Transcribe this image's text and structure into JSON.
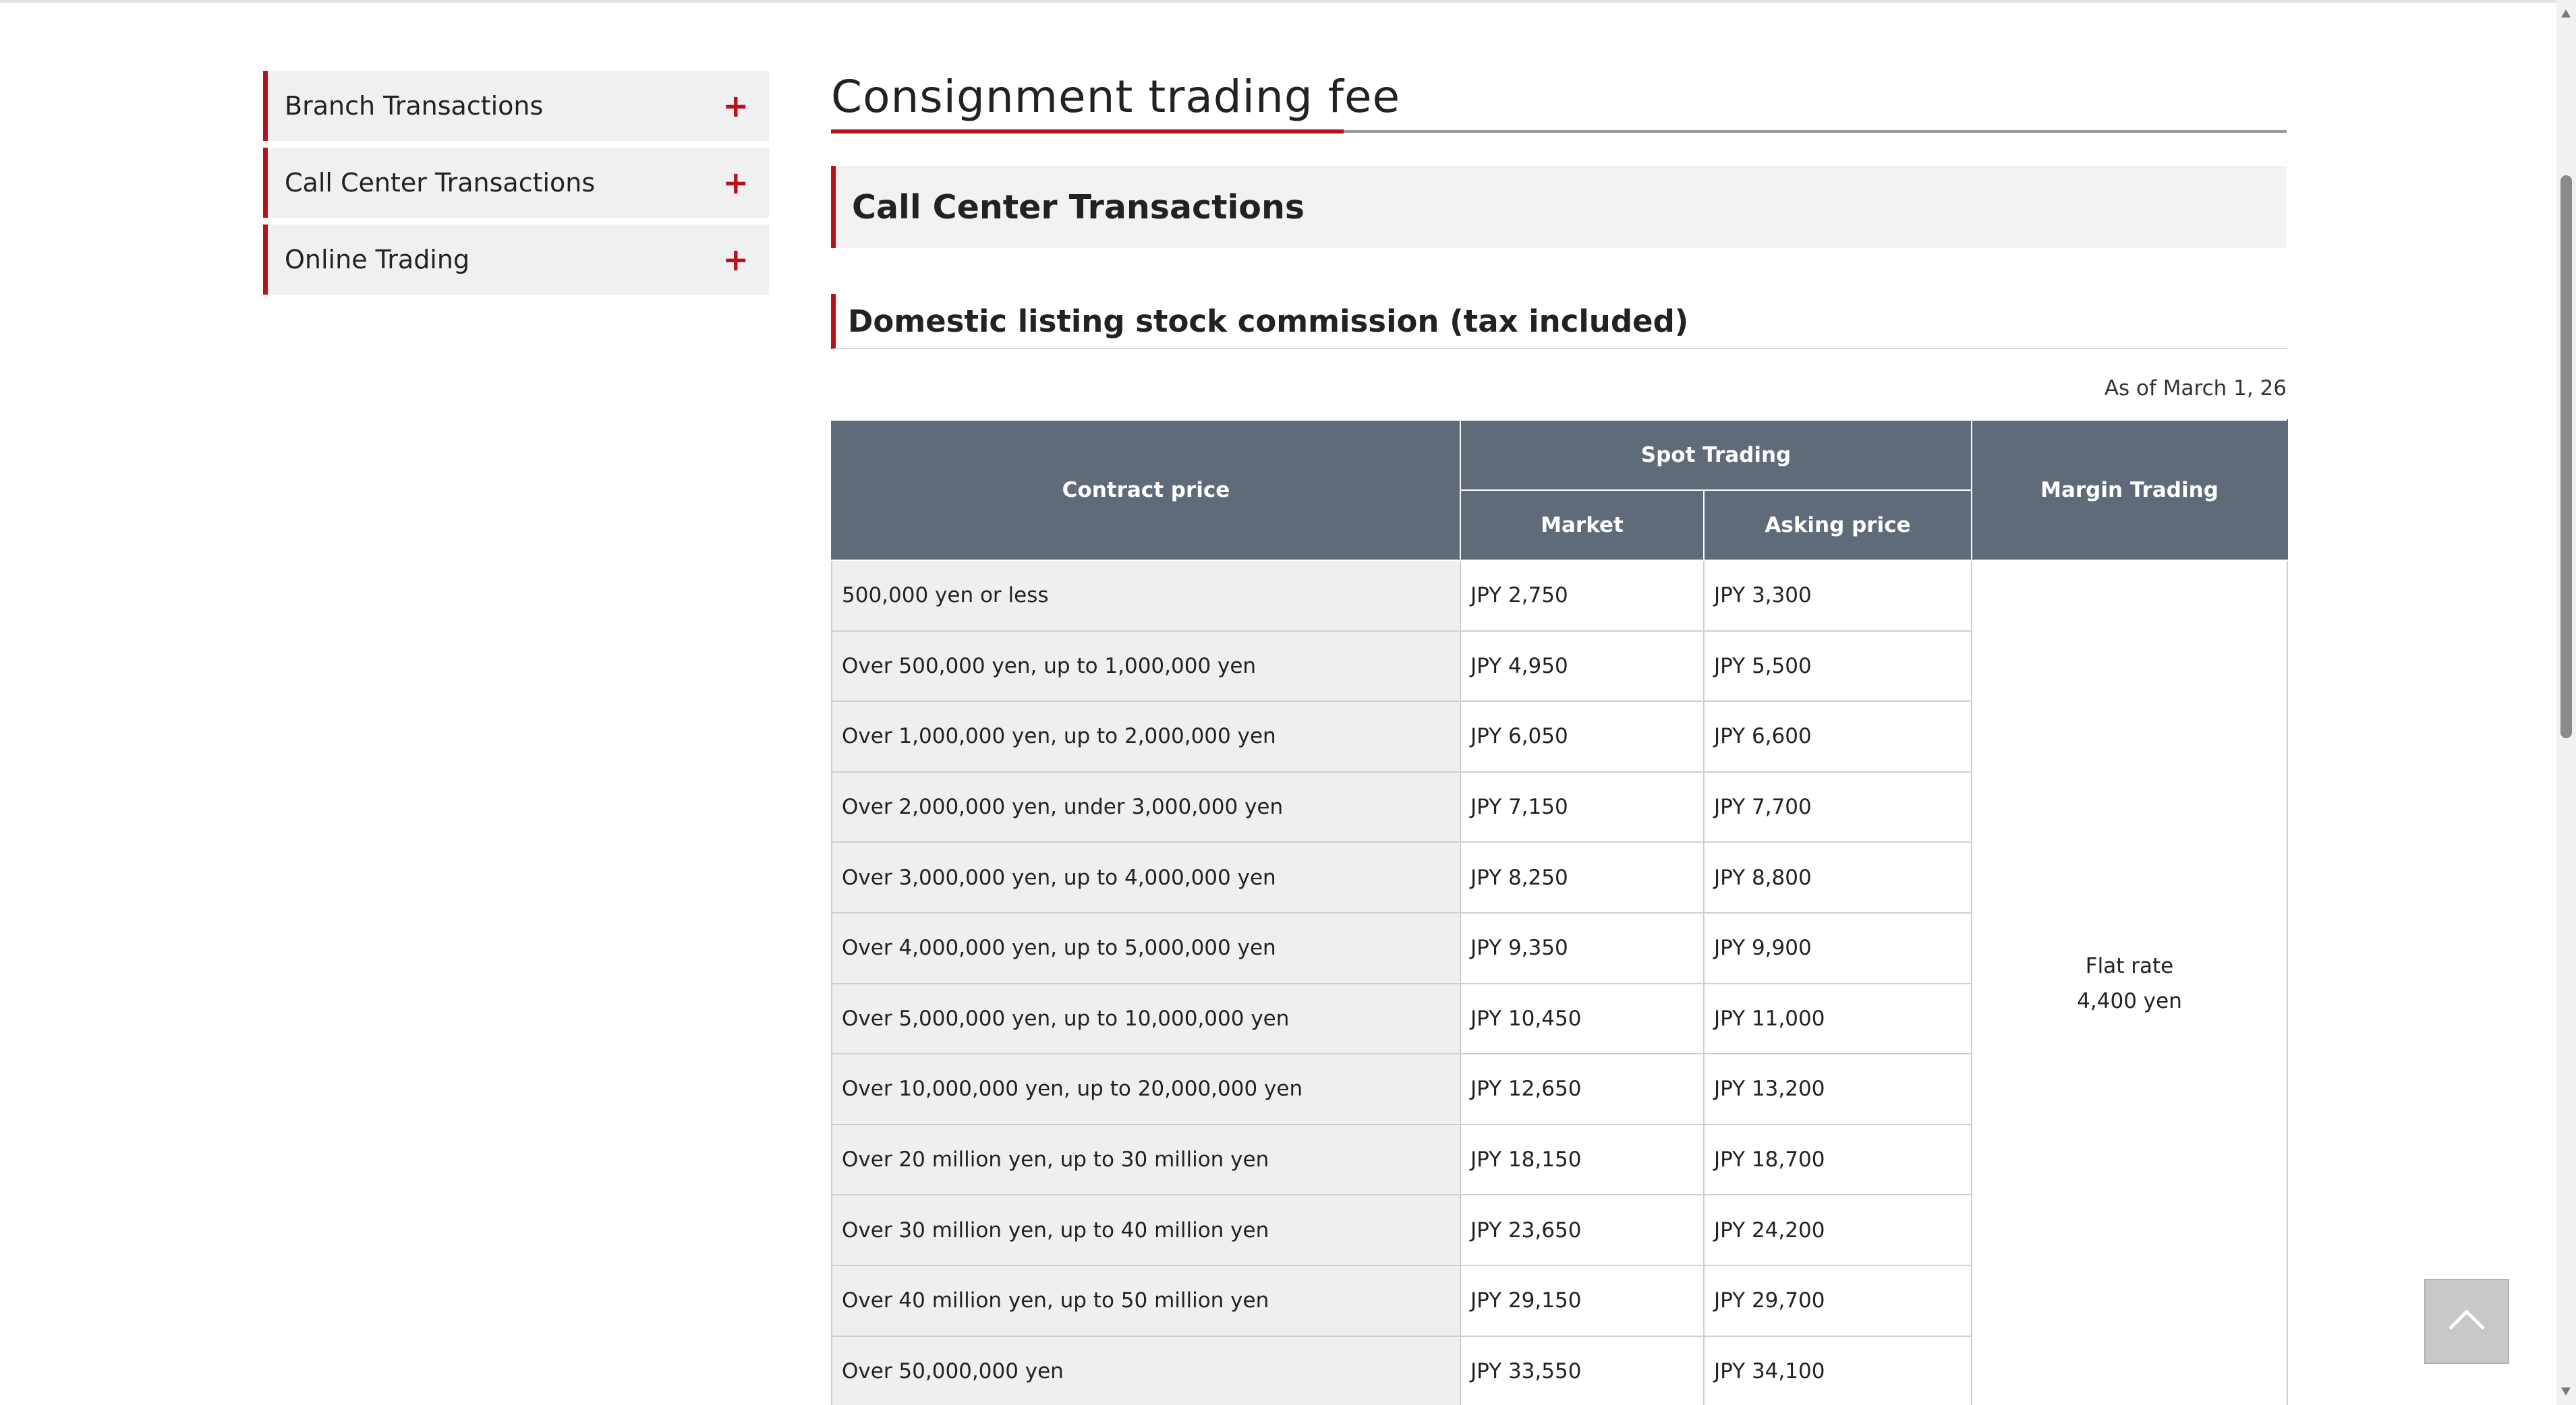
{
  "colors": {
    "accent": "#b5121b",
    "header_bg": "#5f6b79",
    "label_bg": "#efefef"
  },
  "sidebar": {
    "items": [
      {
        "label": "Branch Transactions",
        "icon": "plus-icon"
      },
      {
        "label": "Call Center Transactions",
        "icon": "plus-icon"
      },
      {
        "label": "Online Trading",
        "icon": "plus-icon"
      }
    ]
  },
  "main": {
    "title": "Consignment trading fee",
    "section_title": "Call Center Transactions",
    "sub_title": "Domestic listing stock commission (tax included)",
    "as_of": "As of March 1, 26",
    "table": {
      "headers": {
        "contract_price": "Contract price",
        "spot_trading": "Spot Trading",
        "market": "Market",
        "asking_price": "Asking price",
        "margin_trading": "Margin Trading"
      },
      "rows": [
        {
          "label": "500,000 yen or less",
          "market": "JPY 2,750",
          "asking": "JPY 3,300"
        },
        {
          "label": "Over 500,000 yen, up to 1,000,000 yen",
          "market": "JPY 4,950",
          "asking": "JPY 5,500"
        },
        {
          "label": "Over 1,000,000 yen, up to 2,000,000 yen",
          "market": "JPY 6,050",
          "asking": "JPY 6,600"
        },
        {
          "label": "Over 2,000,000 yen, under 3,000,000 yen",
          "market": "JPY 7,150",
          "asking": "JPY 7,700"
        },
        {
          "label": "Over 3,000,000 yen, up to 4,000,000 yen",
          "market": "JPY 8,250",
          "asking": "JPY 8,800"
        },
        {
          "label": "Over 4,000,000 yen, up to 5,000,000 yen",
          "market": "JPY 9,350",
          "asking": "JPY 9,900"
        },
        {
          "label": "Over 5,000,000 yen, up to 10,000,000 yen",
          "market": "JPY 10,450",
          "asking": "JPY 11,000"
        },
        {
          "label": "Over 10,000,000 yen, up to 20,000,000 yen",
          "market": "JPY 12,650",
          "asking": "JPY 13,200"
        },
        {
          "label": "Over 20 million yen, up to 30 million yen",
          "market": "JPY 18,150",
          "asking": "JPY 18,700"
        },
        {
          "label": "Over 30 million yen, up to 40 million yen",
          "market": "JPY 23,650",
          "asking": "JPY 24,200"
        },
        {
          "label": "Over 40 million yen, up to 50 million yen",
          "market": "JPY 29,150",
          "asking": "JPY 29,700"
        },
        {
          "label": "Over 50,000,000 yen",
          "market": "JPY 33,550",
          "asking": "JPY 34,100"
        }
      ],
      "margin_line1": "Flat rate",
      "margin_line2": "4,400 yen"
    }
  },
  "back_to_top": {
    "icon": "chevron-up-icon"
  }
}
